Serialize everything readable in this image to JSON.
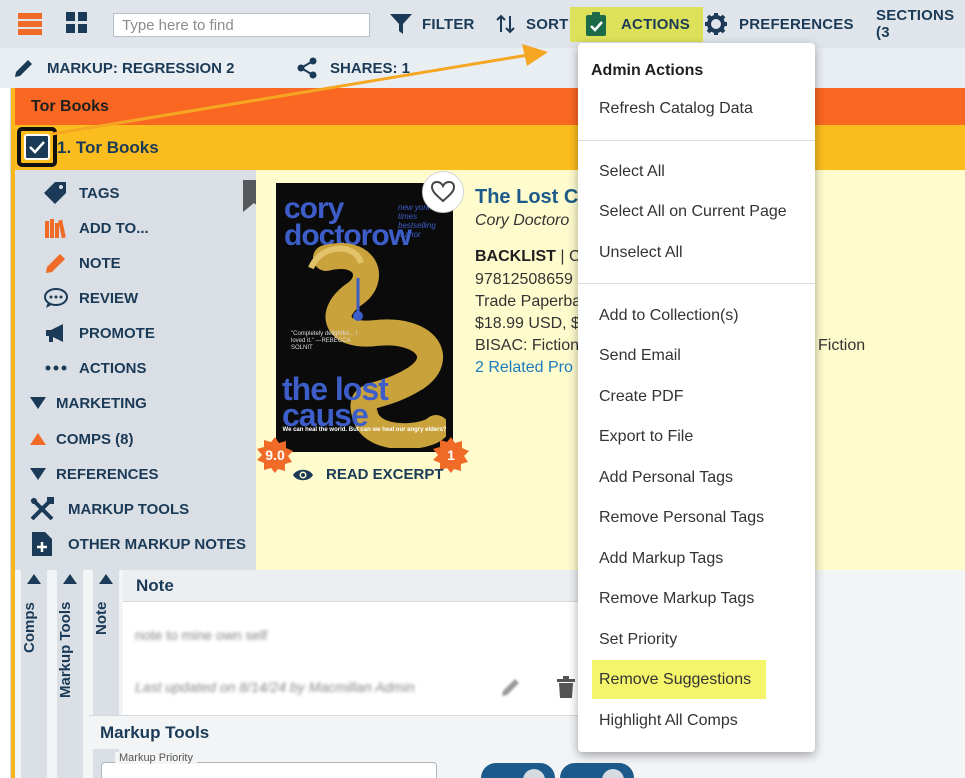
{
  "toolbar": {
    "search_placeholder": "Type here to find",
    "filter_label": "FILTER",
    "sort_label": "SORT",
    "actions_label": "ACTIONS",
    "preferences_label": "PREFERENCES",
    "sections_label": "SECTIONS (3"
  },
  "markup_bar": {
    "markup_label": "MARKUP: REGRESSION 2",
    "shares_label": "SHARES: 1"
  },
  "publisher": {
    "name": "Tor Books",
    "title_row": "1. Tor Books"
  },
  "side_menu": [
    {
      "label": "TAGS",
      "icon": "tag-icon"
    },
    {
      "label": "ADD TO...",
      "icon": "books-icon"
    },
    {
      "label": "NOTE",
      "icon": "pencil-icon"
    },
    {
      "label": "REVIEW",
      "icon": "speech-bubble-icon"
    },
    {
      "label": "PROMOTE",
      "icon": "megaphone-icon"
    },
    {
      "label": "ACTIONS",
      "icon": "ellipsis-icon"
    },
    {
      "label": "MARKETING",
      "icon": "caret-down-icon"
    },
    {
      "label": "COMPS (8)",
      "icon": "caret-up-icon"
    },
    {
      "label": "REFERENCES",
      "icon": "caret-down-icon"
    },
    {
      "label": "MARKUP TOOLS",
      "icon": "tools-icon"
    },
    {
      "label": "OTHER MARKUP NOTES",
      "icon": "note-plus-icon"
    }
  ],
  "book": {
    "cover_author": "cory doctorow",
    "cover_title": "the lost cause",
    "cover_blurb": "new york times bestselling author",
    "cover_quote": "\"Completely delightful... I loved it.\" —REBECCA SOLNIT",
    "cover_tagline": "We can heal the world. But can we heal our angry elders?",
    "title": "The Lost C",
    "author": "Cory Doctoro",
    "status": "BACKLIST",
    "status_rest": " | C",
    "isbn": "97812508659",
    "format": "Trade Paperba",
    "price": "$18.99 USD, $",
    "bisac": "BISAC: Fiction",
    "bisac_rest": "Fiction",
    "related": "2 Related Pro",
    "score_left": "9.0",
    "score_right": "1",
    "excerpt_label": "READ EXCERPT"
  },
  "panels": {
    "comps_tab": "Comps",
    "markup_tools_tab": "Markup Tools",
    "note_tab": "Note",
    "note_title": "Note",
    "note_text": "note to mine own self",
    "note_updated": "Last updated on 8/14/24 by Macmillan Admin",
    "markup_tools_title": "Markup Tools",
    "priority_label": "Markup Priority"
  },
  "dropdown": {
    "header": "Admin Actions",
    "groups": [
      [
        "Refresh Catalog Data"
      ],
      [
        "Select All",
        "Select All on Current Page",
        "Unselect All"
      ],
      [
        "Add to Collection(s)",
        "Send Email",
        "Create PDF",
        "Export to File",
        "Add Personal Tags",
        "Remove Personal Tags",
        "Add Markup Tags",
        "Remove Markup Tags",
        "Set Priority",
        "Remove Suggestions",
        "Highlight All Comps"
      ]
    ]
  },
  "colors": {
    "navy": "#1b3a57",
    "orange_bar": "#fa6722",
    "yellow_bar": "#fbbd1e",
    "highlight": "#f5f56c",
    "annotation_arrow": "#f5a623"
  }
}
